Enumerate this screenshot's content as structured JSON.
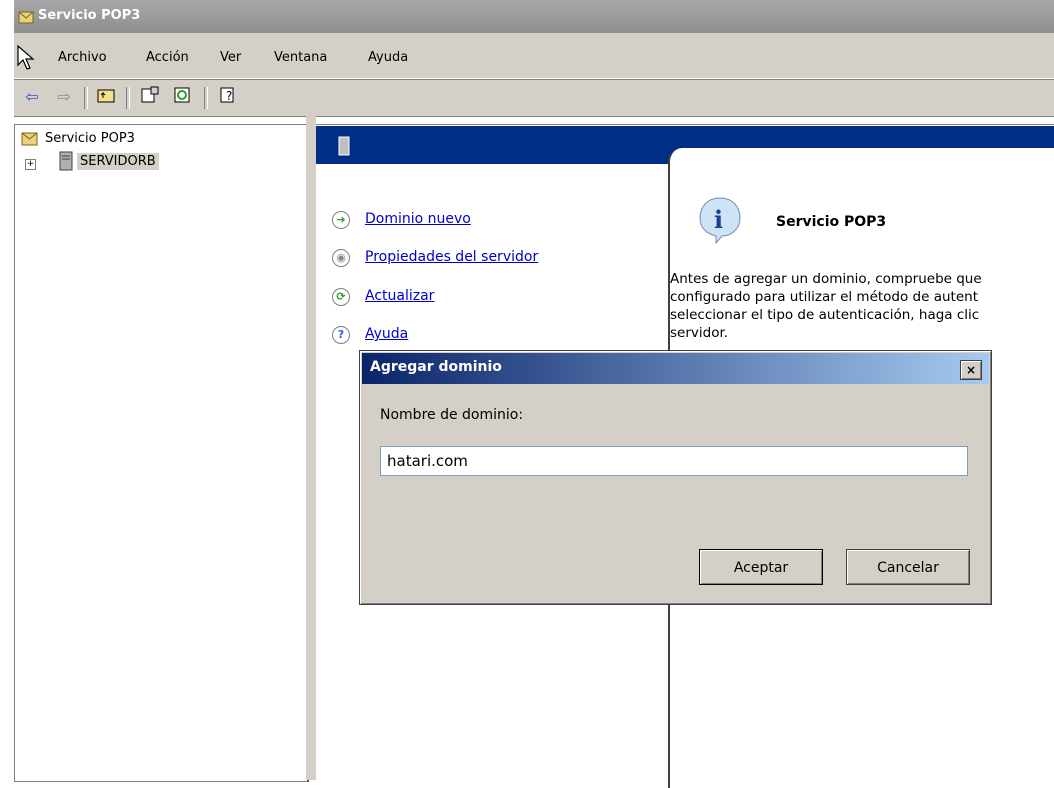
{
  "window": {
    "title": "Servicio POP3"
  },
  "menu": {
    "items": [
      "Archivo",
      "Acción",
      "Ver",
      "Ventana",
      "Ayuda"
    ]
  },
  "toolbar": {
    "buttons": [
      "back-icon",
      "forward-icon",
      "up-folder-icon",
      "properties-icon",
      "refresh-icon",
      "help-icon"
    ]
  },
  "tree": {
    "root": "Servicio POP3",
    "child": "SERVIDORB",
    "expander": "+"
  },
  "tasks": [
    {
      "label": "Dominio nuevo",
      "icon": "arrow-right-icon",
      "color": "#2e9b2e"
    },
    {
      "label": "Propiedades del servidor",
      "icon": "properties-disc-icon",
      "color": "#888888"
    },
    {
      "label": "Actualizar",
      "icon": "refresh-icon",
      "color": "#2e9b2e"
    },
    {
      "label": "Ayuda",
      "icon": "help-icon",
      "color": "#2e5ad7"
    }
  ],
  "info": {
    "title": "Servicio POP3",
    "text_lines": [
      "Antes de agregar un dominio, compruebe que",
      "configurado para utilizar el método de autent",
      "seleccionar el tipo de autenticación, haga clic",
      "servidor."
    ]
  },
  "dialog": {
    "title": "Agregar dominio",
    "close": "×",
    "label": "Nombre de dominio:",
    "input_value": "hatari.com",
    "ok": "Aceptar",
    "cancel": "Cancelar"
  },
  "colors": {
    "banner": "#002d86",
    "dialog_title": "#0a246a",
    "window_bg": "#d4d0c8",
    "link": "#0000cc"
  }
}
